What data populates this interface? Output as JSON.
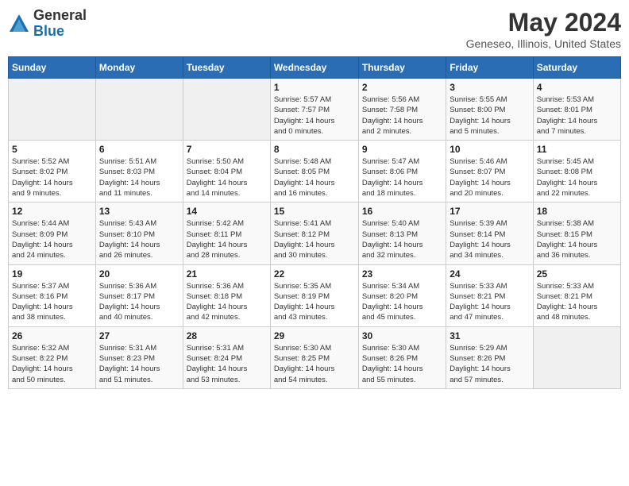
{
  "logo": {
    "general": "General",
    "blue": "Blue"
  },
  "header": {
    "title": "May 2024",
    "subtitle": "Geneseo, Illinois, United States"
  },
  "weekdays": [
    "Sunday",
    "Monday",
    "Tuesday",
    "Wednesday",
    "Thursday",
    "Friday",
    "Saturday"
  ],
  "weeks": [
    [
      {
        "day": "",
        "info": ""
      },
      {
        "day": "",
        "info": ""
      },
      {
        "day": "",
        "info": ""
      },
      {
        "day": "1",
        "info": "Sunrise: 5:57 AM\nSunset: 7:57 PM\nDaylight: 14 hours\nand 0 minutes."
      },
      {
        "day": "2",
        "info": "Sunrise: 5:56 AM\nSunset: 7:58 PM\nDaylight: 14 hours\nand 2 minutes."
      },
      {
        "day": "3",
        "info": "Sunrise: 5:55 AM\nSunset: 8:00 PM\nDaylight: 14 hours\nand 5 minutes."
      },
      {
        "day": "4",
        "info": "Sunrise: 5:53 AM\nSunset: 8:01 PM\nDaylight: 14 hours\nand 7 minutes."
      }
    ],
    [
      {
        "day": "5",
        "info": "Sunrise: 5:52 AM\nSunset: 8:02 PM\nDaylight: 14 hours\nand 9 minutes."
      },
      {
        "day": "6",
        "info": "Sunrise: 5:51 AM\nSunset: 8:03 PM\nDaylight: 14 hours\nand 11 minutes."
      },
      {
        "day": "7",
        "info": "Sunrise: 5:50 AM\nSunset: 8:04 PM\nDaylight: 14 hours\nand 14 minutes."
      },
      {
        "day": "8",
        "info": "Sunrise: 5:48 AM\nSunset: 8:05 PM\nDaylight: 14 hours\nand 16 minutes."
      },
      {
        "day": "9",
        "info": "Sunrise: 5:47 AM\nSunset: 8:06 PM\nDaylight: 14 hours\nand 18 minutes."
      },
      {
        "day": "10",
        "info": "Sunrise: 5:46 AM\nSunset: 8:07 PM\nDaylight: 14 hours\nand 20 minutes."
      },
      {
        "day": "11",
        "info": "Sunrise: 5:45 AM\nSunset: 8:08 PM\nDaylight: 14 hours\nand 22 minutes."
      }
    ],
    [
      {
        "day": "12",
        "info": "Sunrise: 5:44 AM\nSunset: 8:09 PM\nDaylight: 14 hours\nand 24 minutes."
      },
      {
        "day": "13",
        "info": "Sunrise: 5:43 AM\nSunset: 8:10 PM\nDaylight: 14 hours\nand 26 minutes."
      },
      {
        "day": "14",
        "info": "Sunrise: 5:42 AM\nSunset: 8:11 PM\nDaylight: 14 hours\nand 28 minutes."
      },
      {
        "day": "15",
        "info": "Sunrise: 5:41 AM\nSunset: 8:12 PM\nDaylight: 14 hours\nand 30 minutes."
      },
      {
        "day": "16",
        "info": "Sunrise: 5:40 AM\nSunset: 8:13 PM\nDaylight: 14 hours\nand 32 minutes."
      },
      {
        "day": "17",
        "info": "Sunrise: 5:39 AM\nSunset: 8:14 PM\nDaylight: 14 hours\nand 34 minutes."
      },
      {
        "day": "18",
        "info": "Sunrise: 5:38 AM\nSunset: 8:15 PM\nDaylight: 14 hours\nand 36 minutes."
      }
    ],
    [
      {
        "day": "19",
        "info": "Sunrise: 5:37 AM\nSunset: 8:16 PM\nDaylight: 14 hours\nand 38 minutes."
      },
      {
        "day": "20",
        "info": "Sunrise: 5:36 AM\nSunset: 8:17 PM\nDaylight: 14 hours\nand 40 minutes."
      },
      {
        "day": "21",
        "info": "Sunrise: 5:36 AM\nSunset: 8:18 PM\nDaylight: 14 hours\nand 42 minutes."
      },
      {
        "day": "22",
        "info": "Sunrise: 5:35 AM\nSunset: 8:19 PM\nDaylight: 14 hours\nand 43 minutes."
      },
      {
        "day": "23",
        "info": "Sunrise: 5:34 AM\nSunset: 8:20 PM\nDaylight: 14 hours\nand 45 minutes."
      },
      {
        "day": "24",
        "info": "Sunrise: 5:33 AM\nSunset: 8:21 PM\nDaylight: 14 hours\nand 47 minutes."
      },
      {
        "day": "25",
        "info": "Sunrise: 5:33 AM\nSunset: 8:21 PM\nDaylight: 14 hours\nand 48 minutes."
      }
    ],
    [
      {
        "day": "26",
        "info": "Sunrise: 5:32 AM\nSunset: 8:22 PM\nDaylight: 14 hours\nand 50 minutes."
      },
      {
        "day": "27",
        "info": "Sunrise: 5:31 AM\nSunset: 8:23 PM\nDaylight: 14 hours\nand 51 minutes."
      },
      {
        "day": "28",
        "info": "Sunrise: 5:31 AM\nSunset: 8:24 PM\nDaylight: 14 hours\nand 53 minutes."
      },
      {
        "day": "29",
        "info": "Sunrise: 5:30 AM\nSunset: 8:25 PM\nDaylight: 14 hours\nand 54 minutes."
      },
      {
        "day": "30",
        "info": "Sunrise: 5:30 AM\nSunset: 8:26 PM\nDaylight: 14 hours\nand 55 minutes."
      },
      {
        "day": "31",
        "info": "Sunrise: 5:29 AM\nSunset: 8:26 PM\nDaylight: 14 hours\nand 57 minutes."
      },
      {
        "day": "",
        "info": ""
      }
    ]
  ]
}
